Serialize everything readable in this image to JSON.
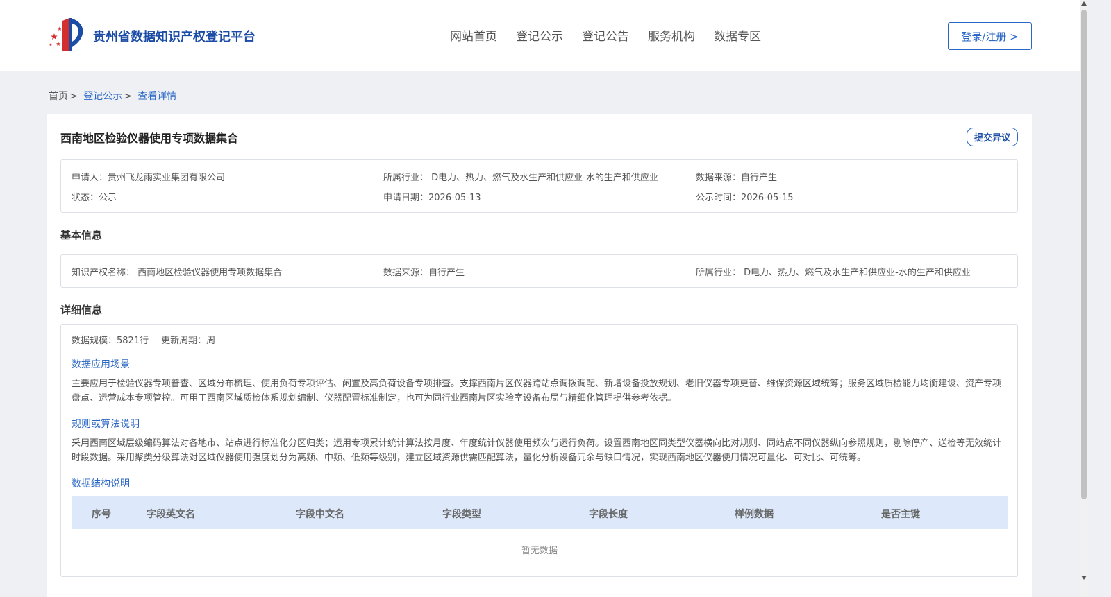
{
  "header": {
    "site_title": "贵州省数据知识产权登记平台",
    "nav": [
      "网站首页",
      "登记公示",
      "登记公告",
      "服务机构",
      "数据专区"
    ],
    "login_label": "登录/注册 >"
  },
  "breadcrumb": {
    "home": "首页",
    "separator": ">",
    "items": [
      "登记公示",
      "查看详情"
    ]
  },
  "record": {
    "title": "西南地区检验仪器使用专项数据集合",
    "objection_label": "提交异议",
    "applicant": "申请人：贵州飞龙雨实业集团有限公司",
    "industry": "所属行业： D电力、热力、燃气及水生产和供应业-水的生产和供应业",
    "data_source": "数据来源：自行产生",
    "status": "状态：公示",
    "apply_date": "申请日期：2026-05-13",
    "publish_date": "公示时间：2026-05-15"
  },
  "basic_info": {
    "section_title": "基本信息",
    "ip_name": "知识产权名称： 西南地区检验仪器使用专项数据集合",
    "data_source": "数据来源：自行产生",
    "industry": "所属行业： D电力、热力、燃气及水生产和供应业-水的生产和供应业"
  },
  "detail_info": {
    "section_title": "详细信息",
    "scale": "数据规模：5821行",
    "update_cycle": "更新周期：周",
    "scenario_title": "数据应用场景",
    "scenario_text": "主要应用于检验仪器专项普查、区域分布梳理、使用负荷专项评估、闲置及高负荷设备专项排查。支撑西南片区仪器跨站点调拨调配、新增设备投放规划、老旧仪器专项更替、维保资源区域统筹；服务区域质检能力均衡建设、资产专项盘点、运营成本专项管控。可用于西南区域质检体系规划编制、仪器配置标准制定，也可为同行业西南片区实验室设备布局与精细化管理提供参考依据。",
    "algorithm_title": "规则或算法说明",
    "algorithm_text": "采用西南区域层级编码算法对各地市、站点进行标准化分区归类；运用专项累计统计算法按月度、年度统计仪器使用频次与运行负荷。设置西南地区同类型仪器横向比对规则、同站点不同仪器纵向参照规则，剔除停产、送检等无效统计时段数据。采用聚类分级算法对区域仪器使用强度划分为高频、中频、低频等级别，建立区域资源供需匹配算法，量化分析设备冗余与缺口情况，实现西南地区仪器使用情况可量化、可对比、可统筹。",
    "structure_title": "数据结构说明",
    "table_headers": [
      "序号",
      "字段英文名",
      "字段中文名",
      "字段类型",
      "字段长度",
      "样例数据",
      "是否主键"
    ],
    "empty_text": "暂无数据"
  },
  "colors": {
    "brand_blue": "#1c4da6",
    "link_blue": "#2b67c6",
    "table_header_bg": "#dde9fb",
    "page_bg": "#eef0f4"
  },
  "icons": [
    "site-logo-icon",
    "scroll-up-icon",
    "scroll-down-icon"
  ]
}
